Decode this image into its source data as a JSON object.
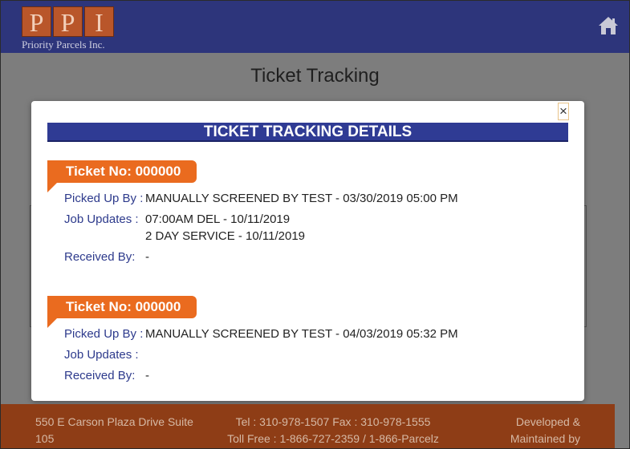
{
  "header": {
    "logo_letters": [
      "P",
      "P",
      "I"
    ],
    "logo_subtitle": "Priority Parcels Inc.",
    "home_icon": "home-icon"
  },
  "page": {
    "title": "Ticket Tracking"
  },
  "modal": {
    "close_label": "×",
    "title": "TICKET TRACKING DETAILS",
    "tickets": [
      {
        "ticket_label": "Ticket No: 000000",
        "picked_up_label": "Picked Up By :",
        "picked_up_value": "MANUALLY SCREENED BY TEST - 03/30/2019 05:00 PM",
        "job_updates_label": "Job Updates :",
        "job_updates": [
          "07:00AM DEL - 10/11/2019",
          "2 DAY SERVICE - 10/11/2019"
        ],
        "received_label": "Received By:",
        "received_value": "-"
      },
      {
        "ticket_label": "Ticket No: 000000",
        "picked_up_label": "Picked Up By :",
        "picked_up_value": "MANUALLY SCREENED BY TEST - 04/03/2019 05:32 PM",
        "job_updates_label": "Job Updates :",
        "job_updates": [],
        "received_label": "Received By:",
        "received_value": "-"
      }
    ]
  },
  "footer": {
    "address_line1": "550 E Carson Plaza Drive Suite",
    "address_line2": "105",
    "phone_line": "Tel : 310-978-1507 Fax : 310-978-1555",
    "tollfree_line": "Toll Free : 1-866-727-2359 / 1-866-Parcelz",
    "developed_line1": "Developed &",
    "developed_line2": "Maintained by"
  },
  "colors": {
    "header_bg": "#2d357b",
    "logo_orange": "#b9562a",
    "modal_title_bg": "#2f3b94",
    "ticket_tag": "#ea6b1f",
    "label_blue": "#2d3a8c",
    "footer_bg": "#8e3d16"
  }
}
